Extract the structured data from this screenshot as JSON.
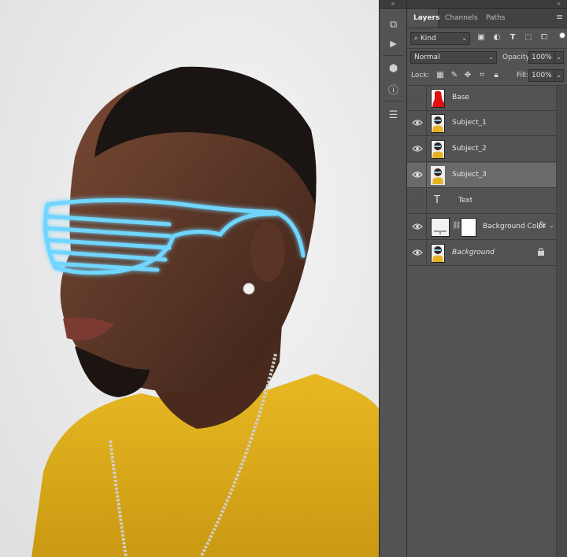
{
  "panel": {
    "collapse_left": "«",
    "collapse_right": "»",
    "tabs": [
      {
        "label": "Layers"
      },
      {
        "label": "Channels"
      },
      {
        "label": "Paths"
      }
    ],
    "menu_icon": "hamburger-menu-icon",
    "filter": {
      "kind_label": "Kind",
      "search_icon": "search-icon"
    },
    "blend_mode": "Normal",
    "opacity_label": "Opacity:",
    "opacity_value": "100%",
    "lock_label": "Lock:",
    "fill_label": "Fill:",
    "fill_value": "100%"
  },
  "layers": [
    {
      "name": "Base",
      "visible": false,
      "thumb": "red-silhouette"
    },
    {
      "name": "Subject_1",
      "visible": true,
      "thumb": "photo"
    },
    {
      "name": "Subject_2",
      "visible": true,
      "thumb": "photo"
    },
    {
      "name": "Subject_3",
      "visible": true,
      "thumb": "photo",
      "selected": true
    },
    {
      "name": "Text",
      "visible": false,
      "thumb": "type-layer"
    },
    {
      "name": "Background Color",
      "visible": true,
      "thumb": "adjustment",
      "fx": "fx"
    },
    {
      "name": "Background",
      "visible": true,
      "thumb": "photo",
      "locked": true
    }
  ],
  "colors": {
    "panel_bg": "#535353",
    "tab_bg": "#424242",
    "selected_row": "#6a6a6a",
    "canvas_bg": "#ececec",
    "shirt": "#e5b321",
    "neon": "#6fd6ff"
  }
}
